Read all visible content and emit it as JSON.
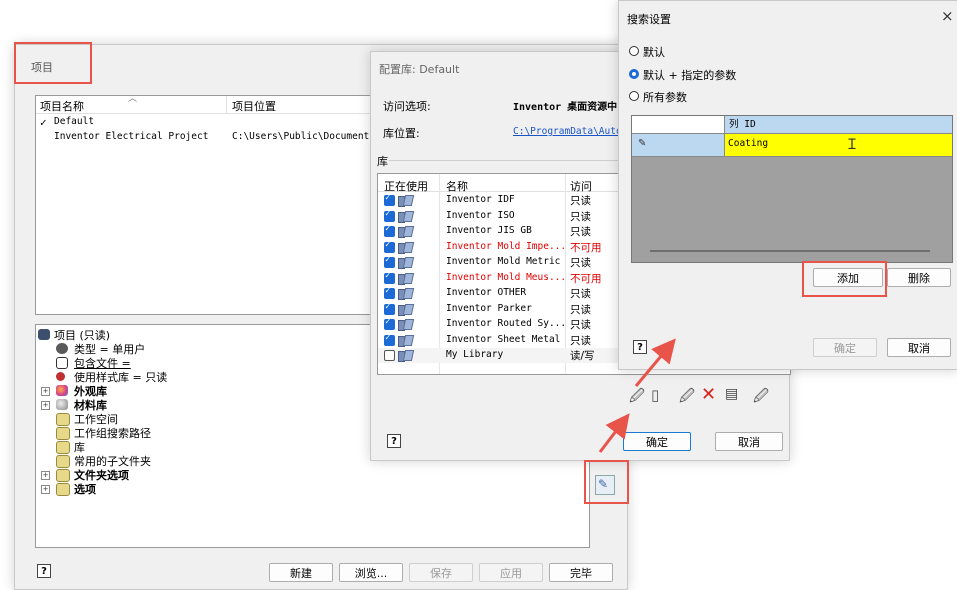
{
  "project_window": {
    "title": "项目",
    "columns": [
      "项目名称",
      "项目位置"
    ],
    "projects": [
      {
        "check": "✓",
        "name": "Default",
        "location": ""
      },
      {
        "check": "",
        "name": "Inventor Electrical Project",
        "location": "C:\\Users\\Public\\Documents\\"
      }
    ],
    "tree": {
      "root": "项目 (只读)",
      "items": [
        {
          "label": "类型 = 单用户",
          "bold": false
        },
        {
          "label": "包含文件 = ",
          "bold": false
        },
        {
          "label": "使用样式库 = 只读",
          "bold": false
        },
        {
          "label": "外观库",
          "bold": true
        },
        {
          "label": "材料库",
          "bold": true
        },
        {
          "label": "工作空间",
          "bold": false
        },
        {
          "label": "工作组搜索路径",
          "bold": false
        },
        {
          "label": "库",
          "bold": false
        },
        {
          "label": "常用的子文件夹",
          "bold": false
        },
        {
          "label": "文件夹选项",
          "bold": true
        },
        {
          "label": "选项",
          "bold": true
        }
      ]
    },
    "buttons": {
      "new": "新建",
      "browse": "浏览...",
      "save": "保存",
      "apply": "应用",
      "done": "完毕"
    },
    "help": "?"
  },
  "config_window": {
    "title": "配置库: Default",
    "access_label": "访问选项:",
    "access_value": "Inventor 桌面资源中",
    "location_label": "库位置:",
    "location_value": "C:\\ProgramData\\Autoc",
    "lib_section": "库",
    "columns": [
      "正在使用",
      "名称",
      "访问"
    ],
    "libraries": [
      {
        "checked": true,
        "name": "Inventor IDF",
        "access": "只读",
        "red": false
      },
      {
        "checked": true,
        "name": "Inventor ISO",
        "access": "只读",
        "red": false
      },
      {
        "checked": true,
        "name": "Inventor JIS GB",
        "access": "只读",
        "red": false
      },
      {
        "checked": true,
        "name": "Inventor Mold Impe...",
        "access": "不可用",
        "red": true
      },
      {
        "checked": true,
        "name": "Inventor Mold Metric",
        "access": "只读",
        "red": false
      },
      {
        "checked": true,
        "name": "Inventor Mold Meus...",
        "access": "不可用",
        "red": true
      },
      {
        "checked": true,
        "name": "Inventor OTHER",
        "access": "只读",
        "red": false
      },
      {
        "checked": true,
        "name": "Inventor Parker",
        "access": "只读",
        "red": false
      },
      {
        "checked": true,
        "name": "Inventor Routed Sy...",
        "access": "只读",
        "red": false
      },
      {
        "checked": true,
        "name": "Inventor Sheet Metal",
        "access": "只读",
        "red": false
      },
      {
        "checked": false,
        "name": "My Library",
        "access": "读/写",
        "red": false
      }
    ],
    "ok": "确定",
    "cancel": "取消",
    "help": "?"
  },
  "search_window": {
    "title": "搜索设置",
    "close": "×",
    "options": [
      "默认",
      "默认 + 指定的参数",
      "所有参数"
    ],
    "selected_option": 1,
    "grid_header": "列 ID",
    "grid_value": "Coating",
    "add": "添加",
    "delete": "删除",
    "ok": "确定",
    "cancel": "取消",
    "help": "?"
  },
  "colors": {
    "highlight_yellow": "#ffff00",
    "header_blue": "#bcd7f0",
    "annotation_red": "#e8534a",
    "link_blue": "#1a55c8",
    "error_red": "#e00000"
  }
}
